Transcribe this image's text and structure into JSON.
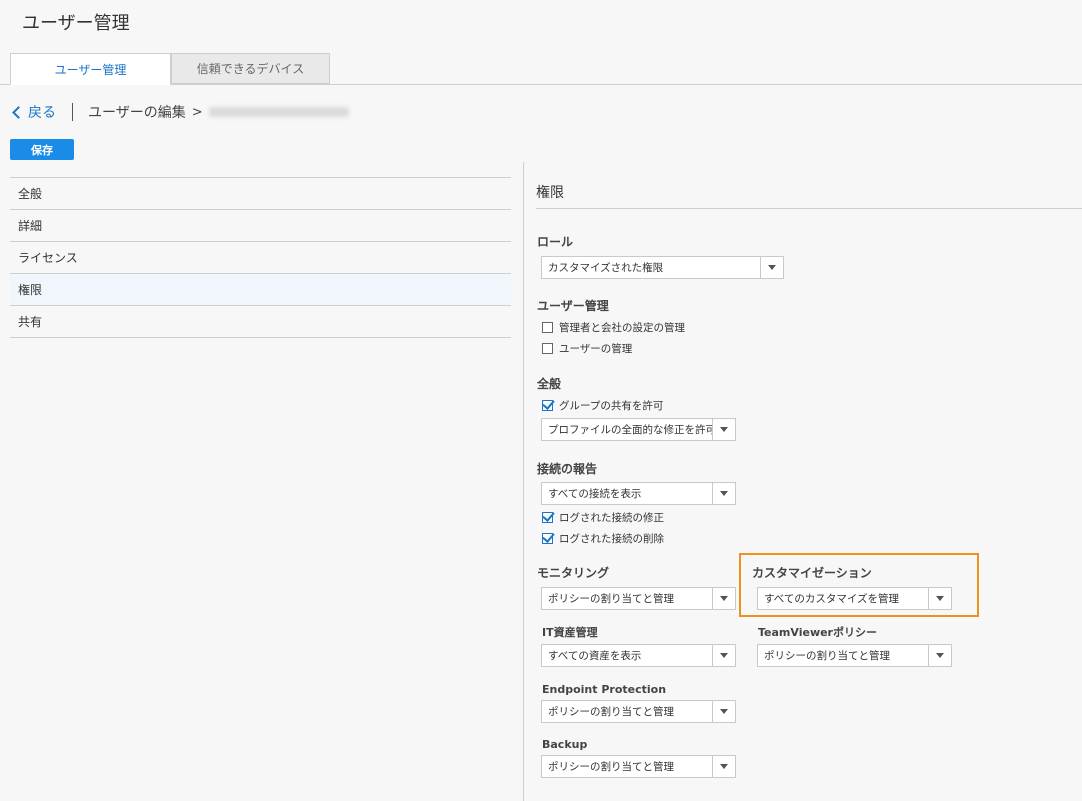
{
  "page": {
    "title": "ユーザー管理"
  },
  "tabs": [
    {
      "label": "ユーザー管理",
      "active": true
    },
    {
      "label": "信頼できるデバイス",
      "active": false
    }
  ],
  "breadcrumb": {
    "back_label": "戻る",
    "edit_label": "ユーザーの編集",
    "arrow": ">"
  },
  "toolbar": {
    "save_label": "保存"
  },
  "sidebar": {
    "items": [
      {
        "label": "全般"
      },
      {
        "label": "詳細"
      },
      {
        "label": "ライセンス"
      },
      {
        "label": "権限",
        "active": true
      },
      {
        "label": "共有"
      }
    ]
  },
  "permissions": {
    "title": "権限",
    "role": {
      "label": "ロール",
      "value": "カスタマイズされた権限"
    },
    "user_management": {
      "label": "ユーザー管理",
      "options": [
        {
          "label": "管理者と会社の設定の管理",
          "checked": false
        },
        {
          "label": "ユーザーの管理",
          "checked": false
        }
      ]
    },
    "general": {
      "label": "全般",
      "share_groups": {
        "label": "グループの共有を許可",
        "checked": true
      },
      "profile_value": "プロファイルの全面的な修正を許可"
    },
    "connection_reports": {
      "label": "接続の報告",
      "value": "すべての接続を表示",
      "modify_logged": {
        "label": "ログされた接続の修正",
        "checked": true
      },
      "delete_logged": {
        "label": "ログされた接続の削除",
        "checked": true
      }
    },
    "monitoring": {
      "label": "モニタリング",
      "value": "ポリシーの割り当てと管理"
    },
    "customization": {
      "label": "カスタマイゼーション",
      "value": "すべてのカスタマイズを管理"
    },
    "it_assets": {
      "label": "IT資産管理",
      "value": "すべての資産を表示"
    },
    "teamviewer_policy": {
      "label": "TeamViewerポリシー",
      "value": "ポリシーの割り当てと管理"
    },
    "endpoint_protection": {
      "label": "Endpoint Protection",
      "value": "ポリシーの割り当てと管理"
    },
    "backup": {
      "label": "Backup",
      "value": "ポリシーの割り当てと管理"
    }
  },
  "colors": {
    "accent": "#1a74c8",
    "save_button": "#1a8ce8",
    "highlight": "#f0901e"
  }
}
